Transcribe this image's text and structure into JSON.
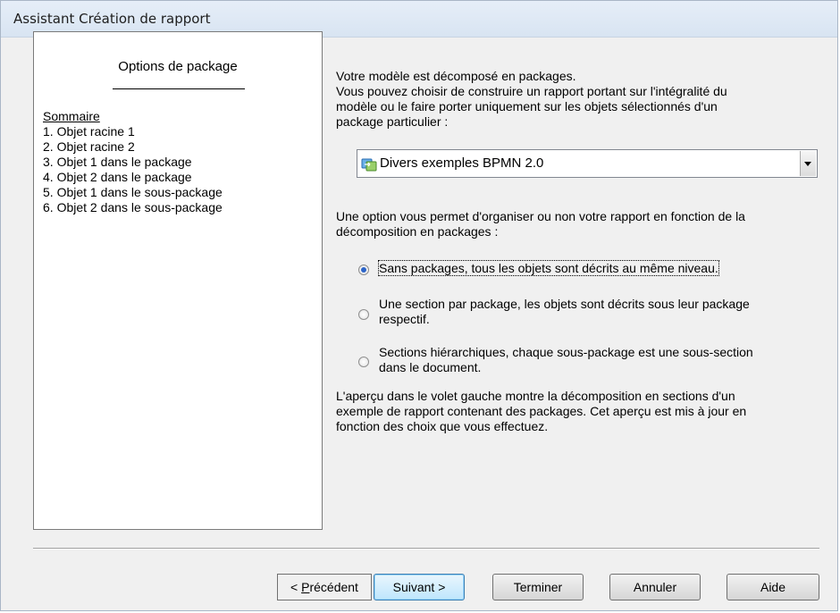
{
  "window": {
    "title": "Assistant Création de rapport"
  },
  "preview": {
    "title": "Options de package",
    "items": [
      "Sommaire",
      "1. Objet racine 1",
      "2. Objet racine 2",
      "3. Objet 1 dans le package",
      "4. Objet 2 dans le package",
      "5. Objet 1 dans le sous-package",
      "6. Objet 2 dans le sous-package"
    ]
  },
  "intro": {
    "line1": "Votre modèle est décomposé en packages.",
    "line2": "Vous pouvez choisir de construire un rapport portant sur l'intégralité du",
    "line3": "modèle ou le faire porter uniquement sur les objets sélectionnés d'un",
    "line4": "package particulier :"
  },
  "package_select": {
    "value": "Divers exemples BPMN 2.0",
    "icon": "package-icon"
  },
  "option_text": {
    "line1": "Une option vous permet d'organiser ou non votre rapport en fonction de la",
    "line2": "décomposition en packages :"
  },
  "options": [
    {
      "line1": "Sans packages, tous les objets sont décrits au même niveau.",
      "line2": "",
      "selected": true
    },
    {
      "line1": "Une section par package, les objets sont décrits sous leur package",
      "line2": "respectif.",
      "selected": false
    },
    {
      "line1": "Sections hiérarchiques, chaque sous-package est une sous-section",
      "line2": "dans le document.",
      "selected": false
    }
  ],
  "note": {
    "line1": "L'aperçu dans le volet gauche montre la décomposition en sections d'un",
    "line2": "exemple de rapport contenant des packages. Cet aperçu est mis à jour en",
    "line3": "fonction des choix que vous effectuez."
  },
  "buttons": {
    "previous_prefix": "< ",
    "previous_accel": "P",
    "previous_rest": "récédent",
    "next": "Suivant >",
    "finish": "Terminer",
    "cancel": "Annuler",
    "help": "Aide"
  }
}
